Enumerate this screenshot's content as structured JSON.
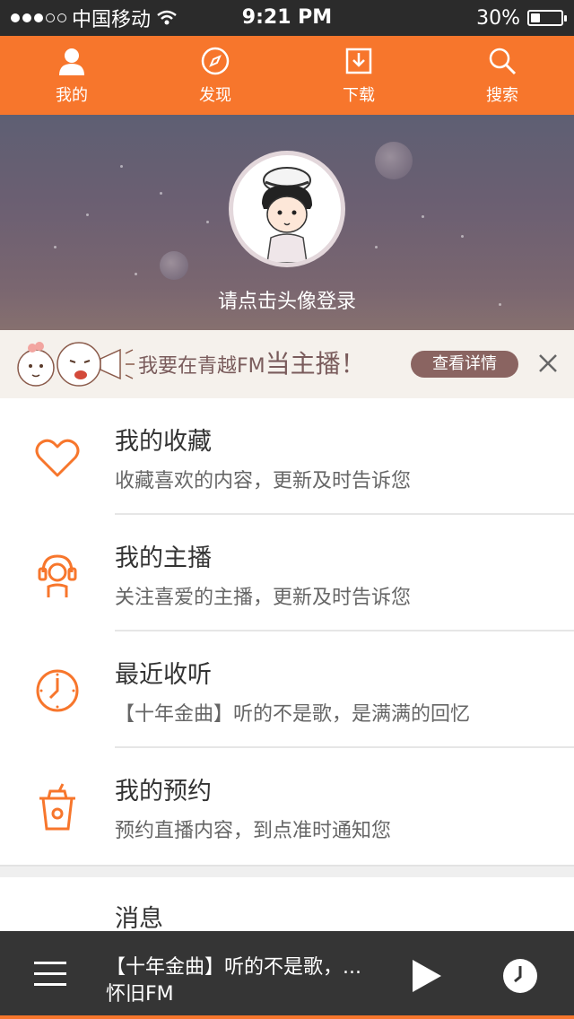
{
  "status_bar": {
    "carrier": "中国移动",
    "time": "9:21 PM",
    "battery": "30%",
    "battery_level": 0.3,
    "signal_bars": 3
  },
  "nav": {
    "tabs": [
      {
        "label": "我的",
        "icon": "user-icon"
      },
      {
        "label": "发现",
        "icon": "compass-icon"
      },
      {
        "label": "下载",
        "icon": "download-icon"
      },
      {
        "label": "搜索",
        "icon": "search-icon"
      }
    ],
    "active_color": "#f7762c"
  },
  "profile": {
    "login_prompt": "请点击头像登录"
  },
  "banner": {
    "text_prefix": "我要在青越FM",
    "text_big": "当主播！",
    "detail_button": "查看详情"
  },
  "menu": {
    "items": [
      {
        "title": "我的收藏",
        "subtitle": "收藏喜欢的内容，更新及时告诉您",
        "icon": "heart-icon"
      },
      {
        "title": "我的主播",
        "subtitle": "关注喜爱的主播，更新及时告诉您",
        "icon": "headphones-person-icon"
      },
      {
        "title": "最近收听",
        "subtitle": "【十年金曲】听的不是歌，是满满的回忆",
        "icon": "clock-icon"
      },
      {
        "title": "我的预约",
        "subtitle": "预约直播内容，到点准时通知您",
        "icon": "cup-icon"
      }
    ],
    "messages": {
      "title": "消息",
      "icon": "message-icon"
    }
  },
  "player": {
    "track": "【十年金曲】听的不是歌，...",
    "station": "怀旧FM"
  }
}
